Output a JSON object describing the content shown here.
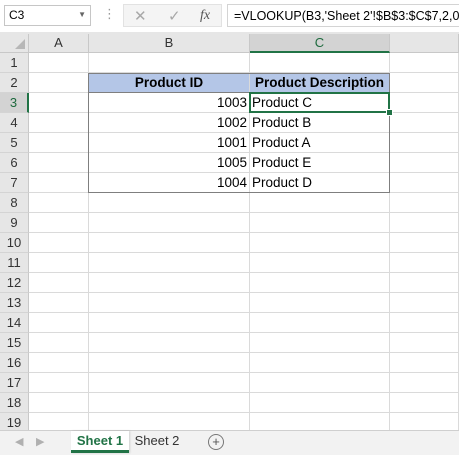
{
  "formula_bar": {
    "name_box": "C3",
    "cancel_icon": "✕",
    "enter_icon": "✓",
    "fx_label": "fx",
    "formula": "=VLOOKUP(B3,'Sheet 2'!$B$3:$C$7,2,0)"
  },
  "columns": [
    "A",
    "B",
    "C"
  ],
  "rows": [
    "1",
    "2",
    "3",
    "4",
    "5",
    "6",
    "7",
    "8",
    "9",
    "10",
    "11",
    "12",
    "13",
    "14",
    "15",
    "16",
    "17",
    "18",
    "19"
  ],
  "selected_cell": "C3",
  "table": {
    "headers": [
      "Product ID",
      "Product Description"
    ],
    "rows": [
      {
        "id": "1003",
        "desc": "Product C"
      },
      {
        "id": "1002",
        "desc": "Product B"
      },
      {
        "id": "1001",
        "desc": "Product A"
      },
      {
        "id": "1005",
        "desc": "Product E"
      },
      {
        "id": "1004",
        "desc": "Product D"
      }
    ]
  },
  "colors": {
    "accent": "#217346",
    "header_fill": "#b4c6e7"
  },
  "sheets": [
    {
      "label": "Sheet 1",
      "active": true
    },
    {
      "label": "Sheet 2",
      "active": false
    }
  ],
  "add_sheet_label": "+"
}
